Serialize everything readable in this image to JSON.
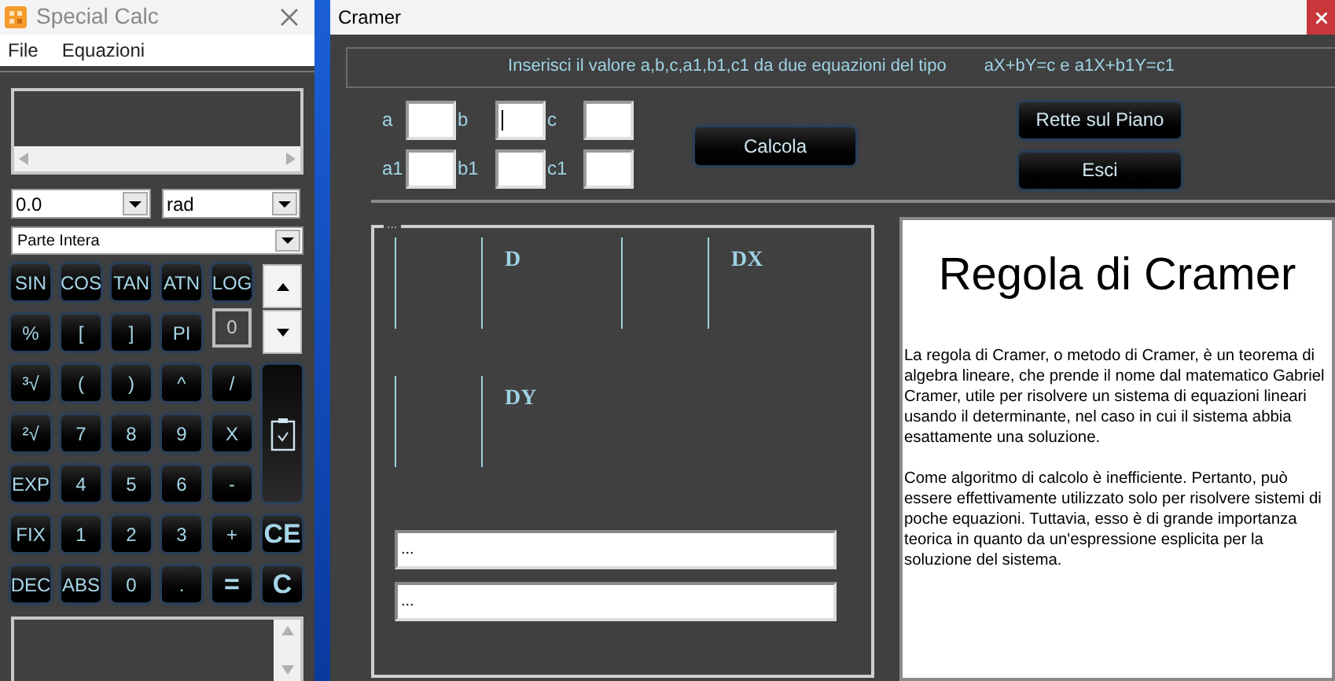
{
  "calc_window": {
    "title": "Special Calc",
    "menu": [
      "File",
      "Equazioni"
    ],
    "precision": "0.0",
    "angle_unit": "rad",
    "mode": "Parte Intera",
    "memory": "0",
    "keys": [
      {
        "label": "SIN",
        "kind": "key"
      },
      {
        "label": "COS",
        "kind": "key"
      },
      {
        "label": "TAN",
        "kind": "key"
      },
      {
        "label": "ATN",
        "kind": "key"
      },
      {
        "label": "LOG",
        "kind": "key"
      },
      {
        "label": "%",
        "kind": "key"
      },
      {
        "label": "[",
        "kind": "key"
      },
      {
        "label": "]",
        "kind": "key"
      },
      {
        "label": "PI",
        "kind": "key"
      },
      {
        "label": "³√",
        "kind": "key"
      },
      {
        "label": "(",
        "kind": "key"
      },
      {
        "label": ")",
        "kind": "key"
      },
      {
        "label": "^",
        "kind": "key"
      },
      {
        "label": "/",
        "kind": "key"
      },
      {
        "label": "²√",
        "kind": "key"
      },
      {
        "label": "7",
        "kind": "key"
      },
      {
        "label": "8",
        "kind": "key"
      },
      {
        "label": "9",
        "kind": "key"
      },
      {
        "label": "X",
        "kind": "key"
      },
      {
        "label": "EXP",
        "kind": "key"
      },
      {
        "label": "4",
        "kind": "key"
      },
      {
        "label": "5",
        "kind": "key"
      },
      {
        "label": "6",
        "kind": "key"
      },
      {
        "label": "-",
        "kind": "key"
      },
      {
        "label": "FIX",
        "kind": "key"
      },
      {
        "label": "1",
        "kind": "key"
      },
      {
        "label": "2",
        "kind": "key"
      },
      {
        "label": "3",
        "kind": "key"
      },
      {
        "label": "+",
        "kind": "key"
      },
      {
        "label": "CE",
        "kind": "big"
      },
      {
        "label": "DEC",
        "kind": "key"
      },
      {
        "label": "ABS",
        "kind": "key"
      },
      {
        "label": "0",
        "kind": "key"
      },
      {
        "label": ".",
        "kind": "key"
      },
      {
        "label": "=",
        "kind": "big"
      },
      {
        "label": "C",
        "kind": "big"
      }
    ]
  },
  "cramer_window": {
    "title": "Cramer",
    "instruction": "Inserisci il valore a,b,c,a1,b1,c1 da due equazioni del tipo",
    "equation": "aX+bY=c  e  a1X+b1Y=c1",
    "inputs": [
      {
        "label": "a",
        "focused": false
      },
      {
        "label": "b",
        "focused": true
      },
      {
        "label": "c",
        "focused": false
      },
      {
        "label": "a1",
        "focused": false
      },
      {
        "label": "b1",
        "focused": false
      },
      {
        "label": "c1",
        "focused": false
      }
    ],
    "calc_button": "Calcola",
    "side_buttons": [
      "Rette sul Piano",
      "Esci"
    ],
    "group_title": "...",
    "determinants": [
      "D",
      "DX",
      "DY"
    ],
    "results": [
      "...",
      "..."
    ],
    "info_title": "Regola di Cramer",
    "info_paragraphs": [
      "La regola di Cramer, o metodo di Cramer, è un teorema di algebra lineare, che prende il nome dal matematico Gabriel Cramer, utile per risolvere un sistema di equazioni lineari usando il determinante, nel caso in cui il sistema abbia esattamente una soluzione.",
      "Come algoritmo di calcolo è inefficiente. Pertanto, può essere effettivamente utilizzato solo per risolvere sistemi di poche equazioni. Tuttavia, esso è di grande importanza teorica in quanto da  un'espressione esplicita per la soluzione del sistema."
    ]
  }
}
